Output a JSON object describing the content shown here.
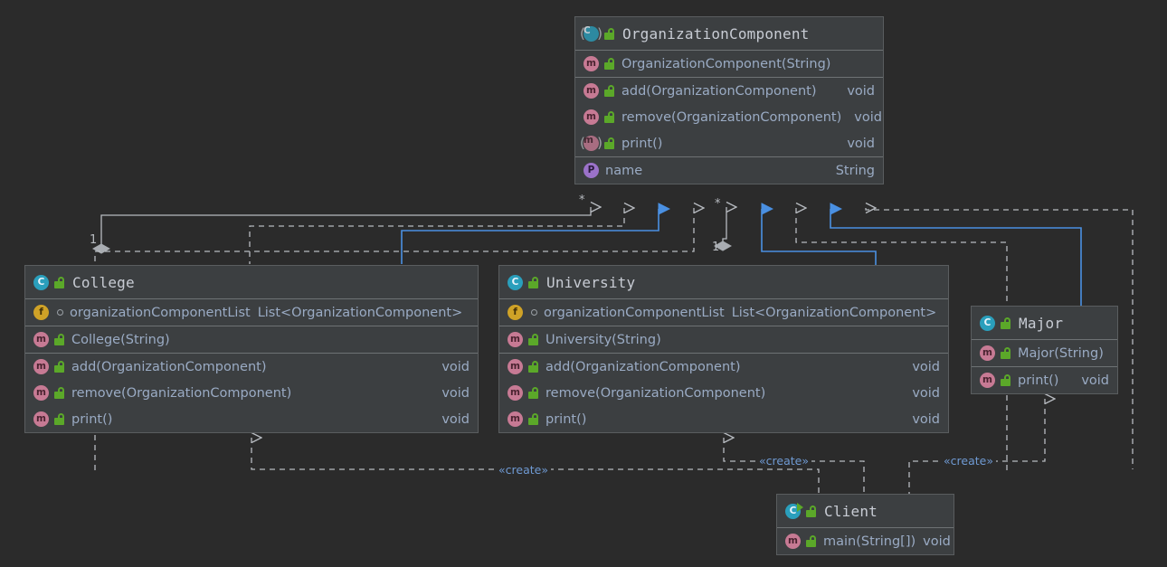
{
  "canvas": {
    "background": "#2b2b2b",
    "box_fill": "#3c3f41",
    "box_border": "#5a5d5f",
    "line_gray": "#b7bbc0",
    "line_blue": "#4a90e2",
    "label_blue": "#6f9ad3"
  },
  "classes": {
    "organization_component": {
      "name": "OrganizationComponent",
      "icon": "abstract-class-icon",
      "visibility_icon": "unlocked-public-icon",
      "groups": [
        {
          "members": [
            {
              "icon": "method-icon",
              "visibility_icon": "unlocked-public-icon",
              "name": "OrganizationComponent(String)",
              "type": ""
            }
          ]
        },
        {
          "members": [
            {
              "icon": "method-icon",
              "visibility_icon": "unlocked-public-icon",
              "name": "add(OrganizationComponent)",
              "type": "void"
            },
            {
              "icon": "method-icon",
              "visibility_icon": "unlocked-public-icon",
              "name": "remove(OrganizationComponent)",
              "type": "void"
            },
            {
              "icon": "abstract-method-icon",
              "visibility_icon": "unlocked-public-icon",
              "name": "print()",
              "type": "void"
            }
          ]
        },
        {
          "members": [
            {
              "icon": "property-icon",
              "visibility_icon": "none",
              "name": "name",
              "type": "String"
            }
          ]
        }
      ]
    },
    "college": {
      "name": "College",
      "icon": "class-icon",
      "visibility_icon": "unlocked-public-icon",
      "groups": [
        {
          "members": [
            {
              "icon": "field-icon",
              "visibility_icon": "package-private-icon",
              "name": "organizationComponentList",
              "type": "List<OrganizationComponent>"
            }
          ]
        },
        {
          "members": [
            {
              "icon": "method-icon",
              "visibility_icon": "unlocked-public-icon",
              "name": "College(String)",
              "type": ""
            }
          ]
        },
        {
          "members": [
            {
              "icon": "method-icon",
              "visibility_icon": "unlocked-public-icon",
              "name": "add(OrganizationComponent)",
              "type": "void"
            },
            {
              "icon": "method-icon",
              "visibility_icon": "unlocked-public-icon",
              "name": "remove(OrganizationComponent)",
              "type": "void"
            },
            {
              "icon": "method-icon",
              "visibility_icon": "unlocked-public-icon",
              "name": "print()",
              "type": "void"
            }
          ]
        }
      ]
    },
    "university": {
      "name": "University",
      "icon": "class-icon",
      "visibility_icon": "unlocked-public-icon",
      "groups": [
        {
          "members": [
            {
              "icon": "field-icon",
              "visibility_icon": "package-private-icon",
              "name": "organizationComponentList",
              "type": "List<OrganizationComponent>"
            }
          ]
        },
        {
          "members": [
            {
              "icon": "method-icon",
              "visibility_icon": "unlocked-public-icon",
              "name": "University(String)",
              "type": ""
            }
          ]
        },
        {
          "members": [
            {
              "icon": "method-icon",
              "visibility_icon": "unlocked-public-icon",
              "name": "add(OrganizationComponent)",
              "type": "void"
            },
            {
              "icon": "method-icon",
              "visibility_icon": "unlocked-public-icon",
              "name": "remove(OrganizationComponent)",
              "type": "void"
            },
            {
              "icon": "method-icon",
              "visibility_icon": "unlocked-public-icon",
              "name": "print()",
              "type": "void"
            }
          ]
        }
      ]
    },
    "major": {
      "name": "Major",
      "icon": "class-icon",
      "visibility_icon": "unlocked-public-icon",
      "groups": [
        {
          "members": [
            {
              "icon": "method-icon",
              "visibility_icon": "unlocked-public-icon",
              "name": "Major(String)",
              "type": ""
            }
          ]
        },
        {
          "members": [
            {
              "icon": "method-icon",
              "visibility_icon": "unlocked-public-icon",
              "name": "print()",
              "type": "void"
            }
          ]
        }
      ]
    },
    "client": {
      "name": "Client",
      "icon": "runnable-class-icon",
      "visibility_icon": "unlocked-public-icon",
      "groups": [
        {
          "members": [
            {
              "icon": "runnable-method-icon",
              "visibility_icon": "unlocked-public-icon",
              "name": "main(String[])",
              "type": "void"
            }
          ]
        }
      ]
    }
  },
  "edge_labels": {
    "create_1": "«create»",
    "create_2": "«create»",
    "create_3": "«create»",
    "mult_star_1": "*",
    "mult_star_2": "*",
    "mult_one_1": "1",
    "mult_one_2": "1"
  }
}
